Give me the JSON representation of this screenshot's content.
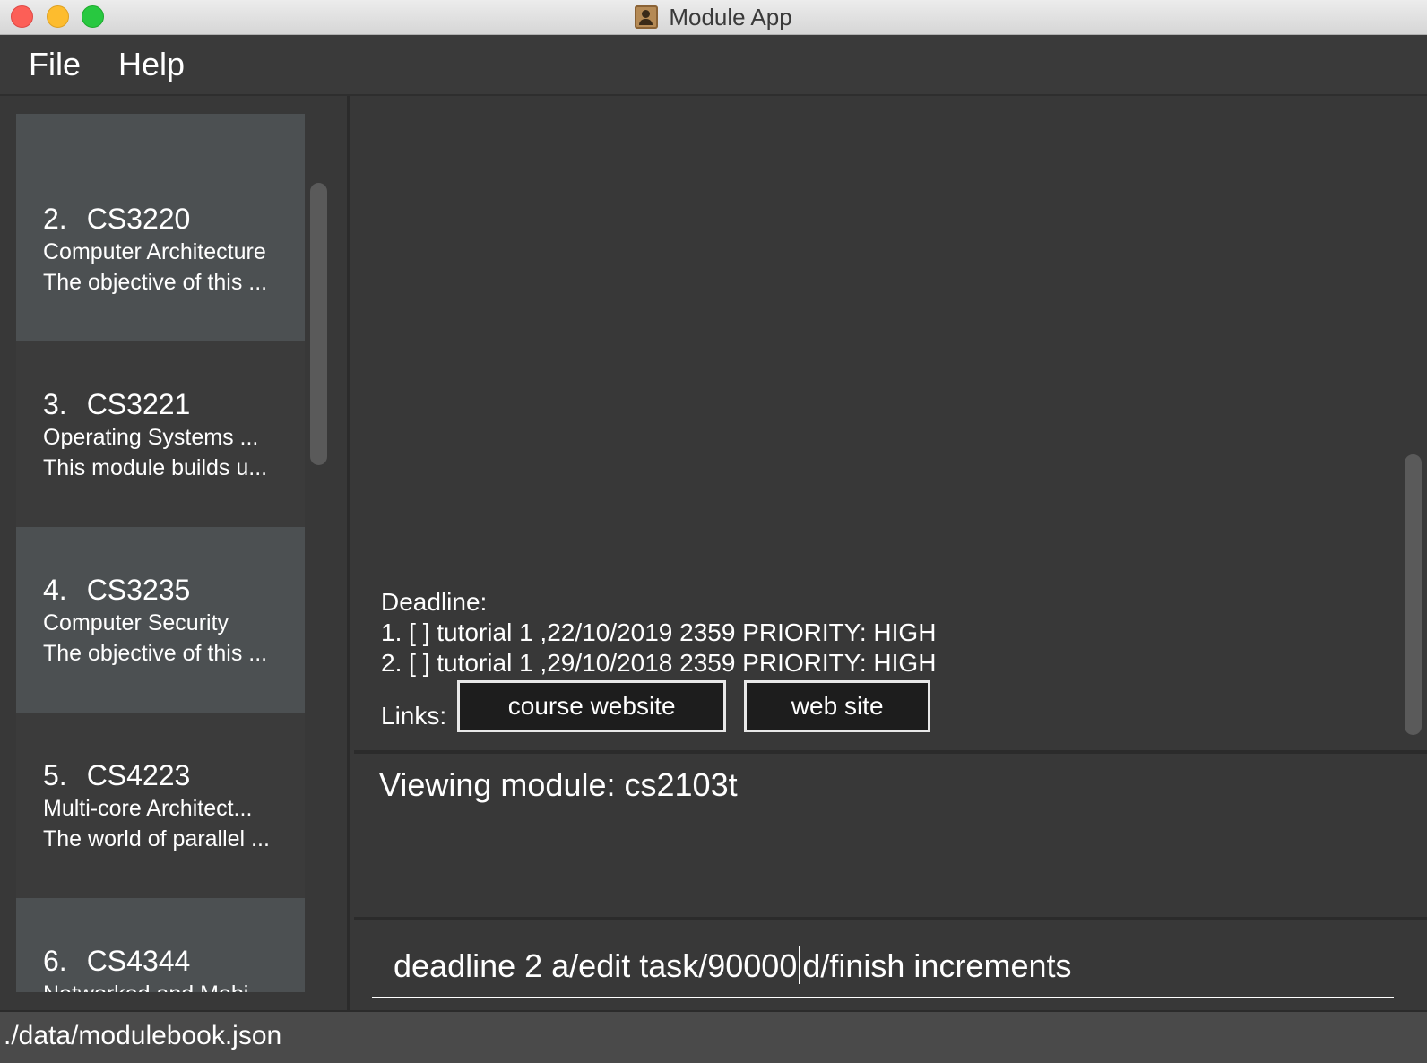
{
  "window": {
    "title": "Module App"
  },
  "menu": {
    "file": "File",
    "help": "Help"
  },
  "modules": [
    {
      "index": "",
      "code": "",
      "name": "",
      "description": ""
    },
    {
      "index": "2.",
      "code": "CS3220",
      "name": "Computer Architecture",
      "description": "The objective of this ..."
    },
    {
      "index": "3.",
      "code": "CS3221",
      "name": "Operating Systems ...",
      "description": "This module builds u..."
    },
    {
      "index": "4.",
      "code": "CS3235",
      "name": "Computer Security",
      "description": "The objective of this ..."
    },
    {
      "index": "5.",
      "code": "CS4223",
      "name": "Multi-core Architect...",
      "description": "The world of parallel ..."
    },
    {
      "index": "6.",
      "code": "CS4344",
      "name": "Networked and Mobi...",
      "description": ""
    }
  ],
  "detail": {
    "deadline_heading": "Deadline:",
    "deadlines": [
      "1. [ ] tutorial 1 ,22/10/2019 2359 PRIORITY: HIGH",
      "2. [ ] tutorial 1 ,29/10/2018 2359 PRIORITY: HIGH"
    ],
    "links_label": "Links:",
    "links": [
      "course website",
      "web site"
    ]
  },
  "result": {
    "text": "Viewing module: cs2103t"
  },
  "command": {
    "before_caret": "deadline 2 a/edit task/90000",
    "after_caret": "d/finish increments"
  },
  "status": {
    "file_path": "./data/modulebook.json"
  }
}
